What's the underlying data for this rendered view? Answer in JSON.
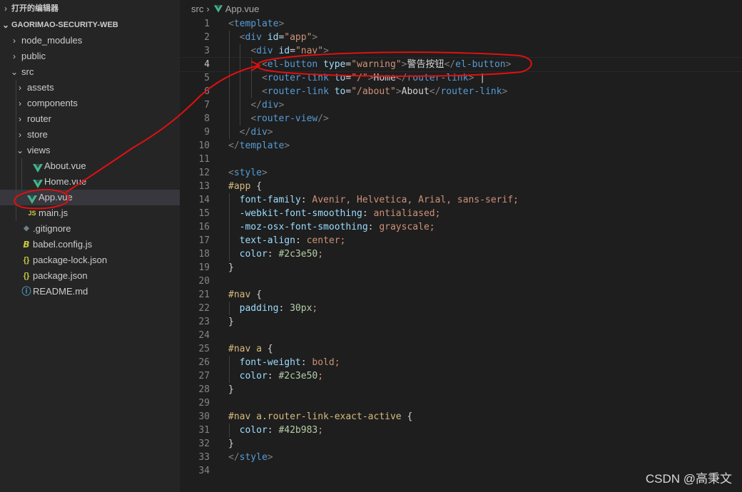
{
  "sidebar": {
    "open_editors": "打开的编辑器",
    "project": "GAORIMAO-SECURITY-WEB",
    "items": [
      {
        "label": "node_modules",
        "kind": "folder",
        "state": "collapsed"
      },
      {
        "label": "public",
        "kind": "folder",
        "state": "collapsed"
      },
      {
        "label": "src",
        "kind": "folder",
        "state": "expanded"
      },
      {
        "label": "assets",
        "kind": "folder",
        "state": "collapsed"
      },
      {
        "label": "components",
        "kind": "folder",
        "state": "collapsed"
      },
      {
        "label": "router",
        "kind": "folder",
        "state": "collapsed"
      },
      {
        "label": "store",
        "kind": "folder",
        "state": "collapsed"
      },
      {
        "label": "views",
        "kind": "folder",
        "state": "expanded"
      },
      {
        "label": "About.vue",
        "kind": "vue"
      },
      {
        "label": "Home.vue",
        "kind": "vue"
      },
      {
        "label": "App.vue",
        "kind": "vue",
        "selected": true
      },
      {
        "label": "main.js",
        "kind": "js",
        "icon_text": "JS"
      },
      {
        "label": ".gitignore",
        "kind": "git"
      },
      {
        "label": "babel.config.js",
        "kind": "babel"
      },
      {
        "label": "package-lock.json",
        "kind": "json",
        "icon_text": "{}"
      },
      {
        "label": "package.json",
        "kind": "json",
        "icon_text": "{}"
      },
      {
        "label": "README.md",
        "kind": "info"
      }
    ]
  },
  "editor": {
    "breadcrumb": {
      "folder": "src",
      "file": "App.vue"
    },
    "active_line": 4,
    "lines": [
      "<template>",
      "  <div id=\"app\">",
      "    <div id=\"nav\">",
      "      <el-button type=\"warning\">警告按钮</el-button>",
      "      <router-link to=\"/\">Home</router-link> |",
      "      <router-link to=\"/about\">About</router-link>",
      "    </div>",
      "    <router-view/>",
      "  </div>",
      "</template>",
      "",
      "<style>",
      "#app {",
      "  font-family: Avenir, Helvetica, Arial, sans-serif;",
      "  -webkit-font-smoothing: antialiased;",
      "  -moz-osx-font-smoothing: grayscale;",
      "  text-align: center;",
      "  color: #2c3e50;",
      "}",
      "",
      "#nav {",
      "  padding: 30px;",
      "}",
      "",
      "#nav a {",
      "  font-weight: bold;",
      "  color: #2c3e50;",
      "}",
      "",
      "#nav a.router-link-exact-active {",
      "  color: #42b983;",
      "}",
      "</style>",
      ""
    ]
  },
  "watermark": "CSDN @高秉文",
  "colors": {
    "sidebar_bg": "#252526",
    "editor_bg": "#1e1e1e",
    "vue_green": "#41b883",
    "js_yellow": "#cbcb41",
    "json_yellow": "#cbcb41",
    "annotation_red": "#e01010"
  }
}
